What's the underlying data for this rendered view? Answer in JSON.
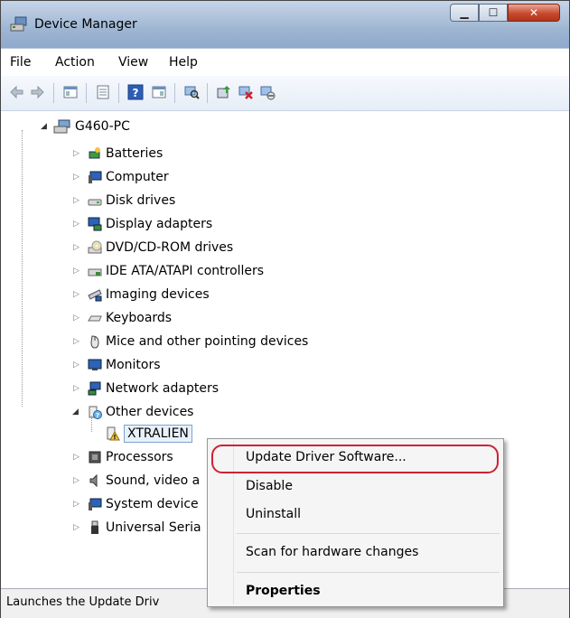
{
  "window": {
    "title": "Device Manager"
  },
  "menu": [
    "File",
    "Action",
    "View",
    "Help"
  ],
  "tree": {
    "root": "G460-PC",
    "categories": [
      "Batteries",
      "Computer",
      "Disk drives",
      "Display adapters",
      "DVD/CD-ROM drives",
      "IDE ATA/ATAPI controllers",
      "Imaging devices",
      "Keyboards",
      "Mice and other pointing devices",
      "Monitors",
      "Network adapters",
      "Other devices"
    ],
    "other_device_child": "XTRALIEN",
    "after_categories": [
      "Processors",
      "Sound, video a",
      "System device",
      "Universal Seria"
    ]
  },
  "context_menu": {
    "items": [
      "Update Driver Software...",
      "Disable",
      "Uninstall",
      "Scan for hardware changes",
      "Properties"
    ]
  },
  "status": {
    "text": "Launches the Update Driv"
  },
  "colors": {
    "highlight": "#cc2233",
    "titlebar": "#9fb6d3"
  }
}
